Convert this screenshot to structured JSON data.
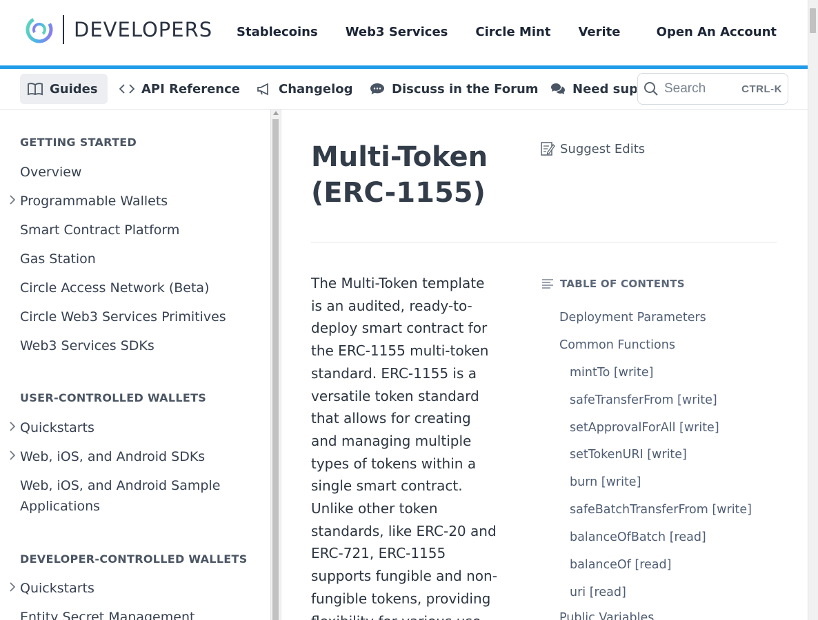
{
  "header": {
    "brand": "DEVELOPERS",
    "nav": [
      "Stablecoins",
      "Web3 Services",
      "Circle Mint",
      "Verite"
    ],
    "open_account": "Open An Account"
  },
  "subnav": {
    "guides": "Guides",
    "api_reference": "API Reference",
    "changelog": "Changelog",
    "forum": "Discuss in the Forum",
    "support": "Need support?",
    "search_placeholder": "Search",
    "search_shortcut": "CTRL-K"
  },
  "sidebar": {
    "section1": {
      "title": "GETTING STARTED",
      "items": [
        "Overview",
        "Programmable Wallets",
        "Smart Contract Platform",
        "Gas Station",
        "Circle Access Network (Beta)",
        "Circle Web3 Services Primitives",
        "Web3 Services SDKs"
      ]
    },
    "section2": {
      "title": "USER-CONTROLLED WALLETS",
      "items": [
        "Quickstarts",
        "Web, iOS, and Android SDKs",
        "Web, iOS, and Android Sample",
        "Applications"
      ]
    },
    "section3": {
      "title": "DEVELOPER-CONTROLLED WALLETS",
      "items": [
        "Quickstarts",
        "Entity Secret Management"
      ]
    }
  },
  "main": {
    "title_line1": "Multi-Token",
    "title_line2": "(ERC-1155)",
    "suggest_edits": "Suggest Edits",
    "body_lines": [
      "The Multi-Token template",
      "is an audited, ready-to-",
      "deploy smart contract for",
      "the ERC-1155 multi-token",
      "standard. ERC-1155 is a",
      "versatile token standard",
      "that allows for creating",
      "and managing multiple",
      "types of tokens within a",
      "single smart contract.",
      "Unlike other token",
      "standards, like ERC-20 and",
      "ERC-721, ERC-1155",
      "supports fungible and non-",
      "fungible tokens, providing",
      "flexibility for various use"
    ]
  },
  "toc": {
    "heading": "TABLE OF CONTENTS",
    "items": [
      "Deployment Parameters",
      "Common Functions",
      "mintTo [write]",
      "safeTransferFrom [write]",
      "setApprovalForAll [write]",
      "setTokenURI [write]",
      "burn [write]",
      "safeBatchTransferFrom [write]",
      "balanceOfBatch [read]",
      "balanceOf [read]",
      "uri [read]",
      "Public Variables"
    ]
  },
  "colors": {
    "accent_blue": "#1e9be9",
    "text_dark": "#1b2435",
    "toc_text": "#4f5d73"
  }
}
